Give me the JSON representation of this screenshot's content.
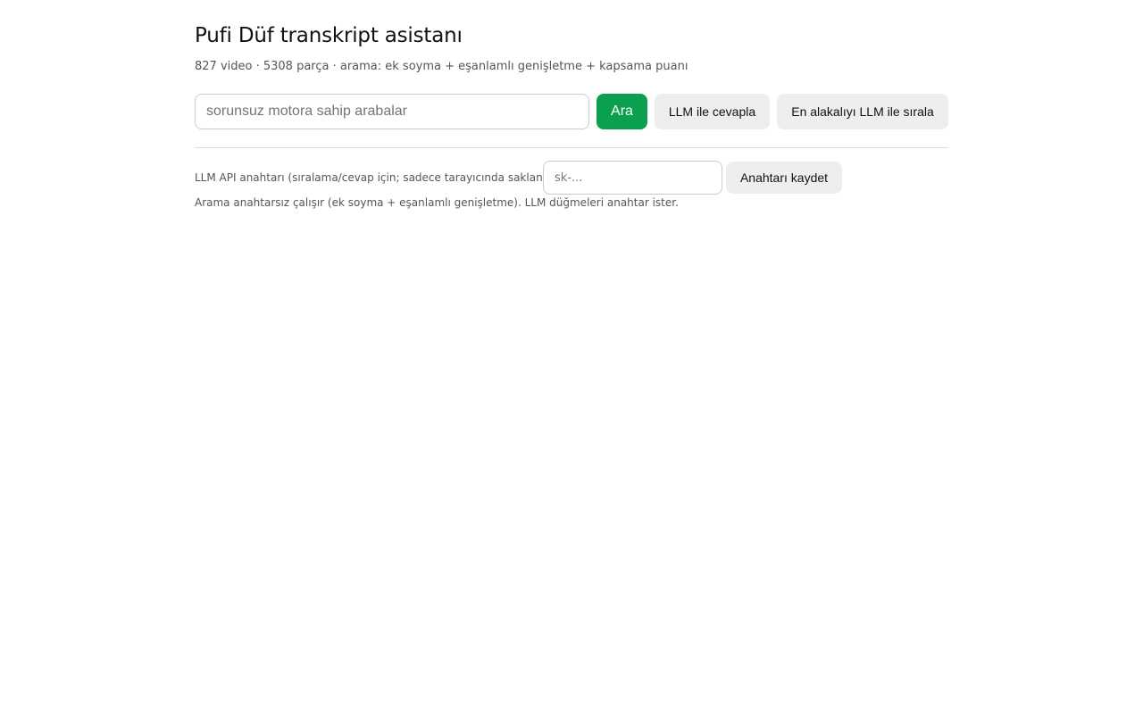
{
  "header": {
    "title": "Pufi Düf transkript asistanı",
    "subtitle": "827 video · 5308 parça · arama: ek soyma + eşanlamlı genişletme + kapsama puanı"
  },
  "search": {
    "value": "",
    "placeholder": "sorunsuz motora sahip arabalar",
    "search_button": "Ara",
    "answer_button": "LLM ile cevapla",
    "rank_button": "En alakalıyı LLM ile sırala"
  },
  "api_key": {
    "label": "LLM API anahtarı (sıralama/cevap için; sadece tarayıcında saklanır):",
    "placeholder": "sk-...",
    "value": "",
    "save_button": "Anahtarı kaydet",
    "hint": "Arama anahtarsız çalışır (ek soyma + eşanlamlı genişletme). LLM düğmeleri anahtar ister."
  },
  "colors": {
    "primary": "#0aa04f",
    "secondary_button": "#eeeeee",
    "muted_text": "#555555"
  }
}
